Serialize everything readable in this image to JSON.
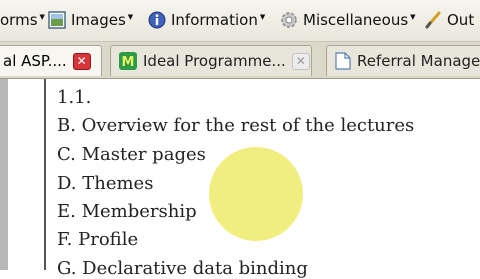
{
  "toolbar": {
    "items": [
      {
        "label": "orms",
        "icon": "forms-icon",
        "dropdown": true
      },
      {
        "label": "Images",
        "icon": "image-icon",
        "dropdown": true
      },
      {
        "label": "Information",
        "icon": "info-icon",
        "dropdown": true
      },
      {
        "label": "Miscellaneous",
        "icon": "gear-icon",
        "dropdown": true
      },
      {
        "label": "Out",
        "icon": "brush-icon",
        "dropdown": false
      }
    ]
  },
  "tabs": [
    {
      "label": "al ASP....",
      "active": true,
      "close_style": "red"
    },
    {
      "label": "Ideal Programme...",
      "icon": "m-icon",
      "active": false,
      "close_style": "grey"
    },
    {
      "label": "Referral Manage",
      "icon": "document-icon",
      "active": false
    }
  ],
  "document": {
    "lines": [
      "1.1.",
      "B. Overview for the rest of the lectures",
      "C. Master pages",
      "D. Themes",
      "E. Membership",
      "F. Profile",
      "G. Declarative data binding"
    ]
  },
  "colors": {
    "highlight": "#ece850",
    "close_red": "#d9343a",
    "info_blue": "#3d62b8"
  }
}
